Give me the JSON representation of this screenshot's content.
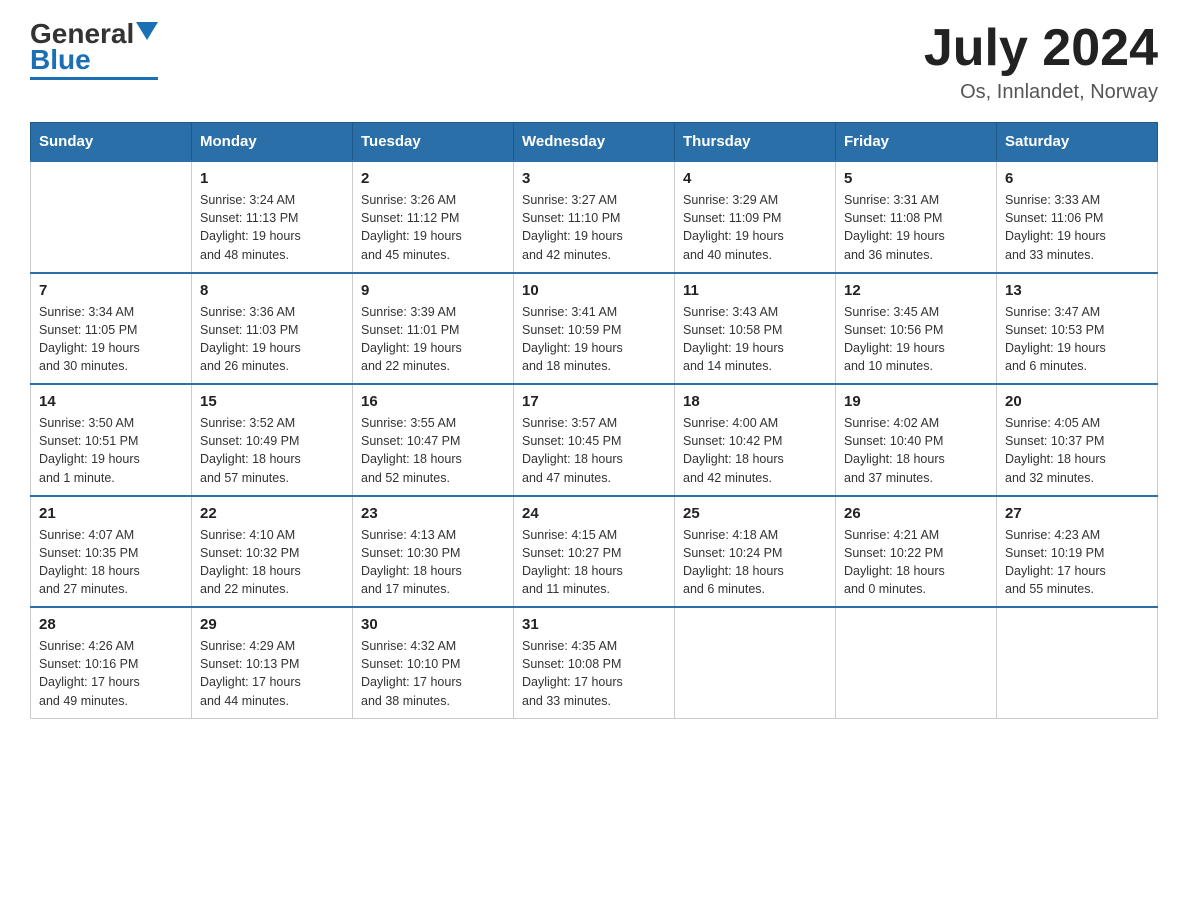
{
  "header": {
    "logo_general": "General",
    "logo_blue": "Blue",
    "title": "July 2024",
    "subtitle": "Os, Innlandet, Norway"
  },
  "calendar": {
    "days_of_week": [
      "Sunday",
      "Monday",
      "Tuesday",
      "Wednesday",
      "Thursday",
      "Friday",
      "Saturday"
    ],
    "weeks": [
      [
        {
          "day": "",
          "info": ""
        },
        {
          "day": "1",
          "info": "Sunrise: 3:24 AM\nSunset: 11:13 PM\nDaylight: 19 hours\nand 48 minutes."
        },
        {
          "day": "2",
          "info": "Sunrise: 3:26 AM\nSunset: 11:12 PM\nDaylight: 19 hours\nand 45 minutes."
        },
        {
          "day": "3",
          "info": "Sunrise: 3:27 AM\nSunset: 11:10 PM\nDaylight: 19 hours\nand 42 minutes."
        },
        {
          "day": "4",
          "info": "Sunrise: 3:29 AM\nSunset: 11:09 PM\nDaylight: 19 hours\nand 40 minutes."
        },
        {
          "day": "5",
          "info": "Sunrise: 3:31 AM\nSunset: 11:08 PM\nDaylight: 19 hours\nand 36 minutes."
        },
        {
          "day": "6",
          "info": "Sunrise: 3:33 AM\nSunset: 11:06 PM\nDaylight: 19 hours\nand 33 minutes."
        }
      ],
      [
        {
          "day": "7",
          "info": "Sunrise: 3:34 AM\nSunset: 11:05 PM\nDaylight: 19 hours\nand 30 minutes."
        },
        {
          "day": "8",
          "info": "Sunrise: 3:36 AM\nSunset: 11:03 PM\nDaylight: 19 hours\nand 26 minutes."
        },
        {
          "day": "9",
          "info": "Sunrise: 3:39 AM\nSunset: 11:01 PM\nDaylight: 19 hours\nand 22 minutes."
        },
        {
          "day": "10",
          "info": "Sunrise: 3:41 AM\nSunset: 10:59 PM\nDaylight: 19 hours\nand 18 minutes."
        },
        {
          "day": "11",
          "info": "Sunrise: 3:43 AM\nSunset: 10:58 PM\nDaylight: 19 hours\nand 14 minutes."
        },
        {
          "day": "12",
          "info": "Sunrise: 3:45 AM\nSunset: 10:56 PM\nDaylight: 19 hours\nand 10 minutes."
        },
        {
          "day": "13",
          "info": "Sunrise: 3:47 AM\nSunset: 10:53 PM\nDaylight: 19 hours\nand 6 minutes."
        }
      ],
      [
        {
          "day": "14",
          "info": "Sunrise: 3:50 AM\nSunset: 10:51 PM\nDaylight: 19 hours\nand 1 minute."
        },
        {
          "day": "15",
          "info": "Sunrise: 3:52 AM\nSunset: 10:49 PM\nDaylight: 18 hours\nand 57 minutes."
        },
        {
          "day": "16",
          "info": "Sunrise: 3:55 AM\nSunset: 10:47 PM\nDaylight: 18 hours\nand 52 minutes."
        },
        {
          "day": "17",
          "info": "Sunrise: 3:57 AM\nSunset: 10:45 PM\nDaylight: 18 hours\nand 47 minutes."
        },
        {
          "day": "18",
          "info": "Sunrise: 4:00 AM\nSunset: 10:42 PM\nDaylight: 18 hours\nand 42 minutes."
        },
        {
          "day": "19",
          "info": "Sunrise: 4:02 AM\nSunset: 10:40 PM\nDaylight: 18 hours\nand 37 minutes."
        },
        {
          "day": "20",
          "info": "Sunrise: 4:05 AM\nSunset: 10:37 PM\nDaylight: 18 hours\nand 32 minutes."
        }
      ],
      [
        {
          "day": "21",
          "info": "Sunrise: 4:07 AM\nSunset: 10:35 PM\nDaylight: 18 hours\nand 27 minutes."
        },
        {
          "day": "22",
          "info": "Sunrise: 4:10 AM\nSunset: 10:32 PM\nDaylight: 18 hours\nand 22 minutes."
        },
        {
          "day": "23",
          "info": "Sunrise: 4:13 AM\nSunset: 10:30 PM\nDaylight: 18 hours\nand 17 minutes."
        },
        {
          "day": "24",
          "info": "Sunrise: 4:15 AM\nSunset: 10:27 PM\nDaylight: 18 hours\nand 11 minutes."
        },
        {
          "day": "25",
          "info": "Sunrise: 4:18 AM\nSunset: 10:24 PM\nDaylight: 18 hours\nand 6 minutes."
        },
        {
          "day": "26",
          "info": "Sunrise: 4:21 AM\nSunset: 10:22 PM\nDaylight: 18 hours\nand 0 minutes."
        },
        {
          "day": "27",
          "info": "Sunrise: 4:23 AM\nSunset: 10:19 PM\nDaylight: 17 hours\nand 55 minutes."
        }
      ],
      [
        {
          "day": "28",
          "info": "Sunrise: 4:26 AM\nSunset: 10:16 PM\nDaylight: 17 hours\nand 49 minutes."
        },
        {
          "day": "29",
          "info": "Sunrise: 4:29 AM\nSunset: 10:13 PM\nDaylight: 17 hours\nand 44 minutes."
        },
        {
          "day": "30",
          "info": "Sunrise: 4:32 AM\nSunset: 10:10 PM\nDaylight: 17 hours\nand 38 minutes."
        },
        {
          "day": "31",
          "info": "Sunrise: 4:35 AM\nSunset: 10:08 PM\nDaylight: 17 hours\nand 33 minutes."
        },
        {
          "day": "",
          "info": ""
        },
        {
          "day": "",
          "info": ""
        },
        {
          "day": "",
          "info": ""
        }
      ]
    ]
  }
}
